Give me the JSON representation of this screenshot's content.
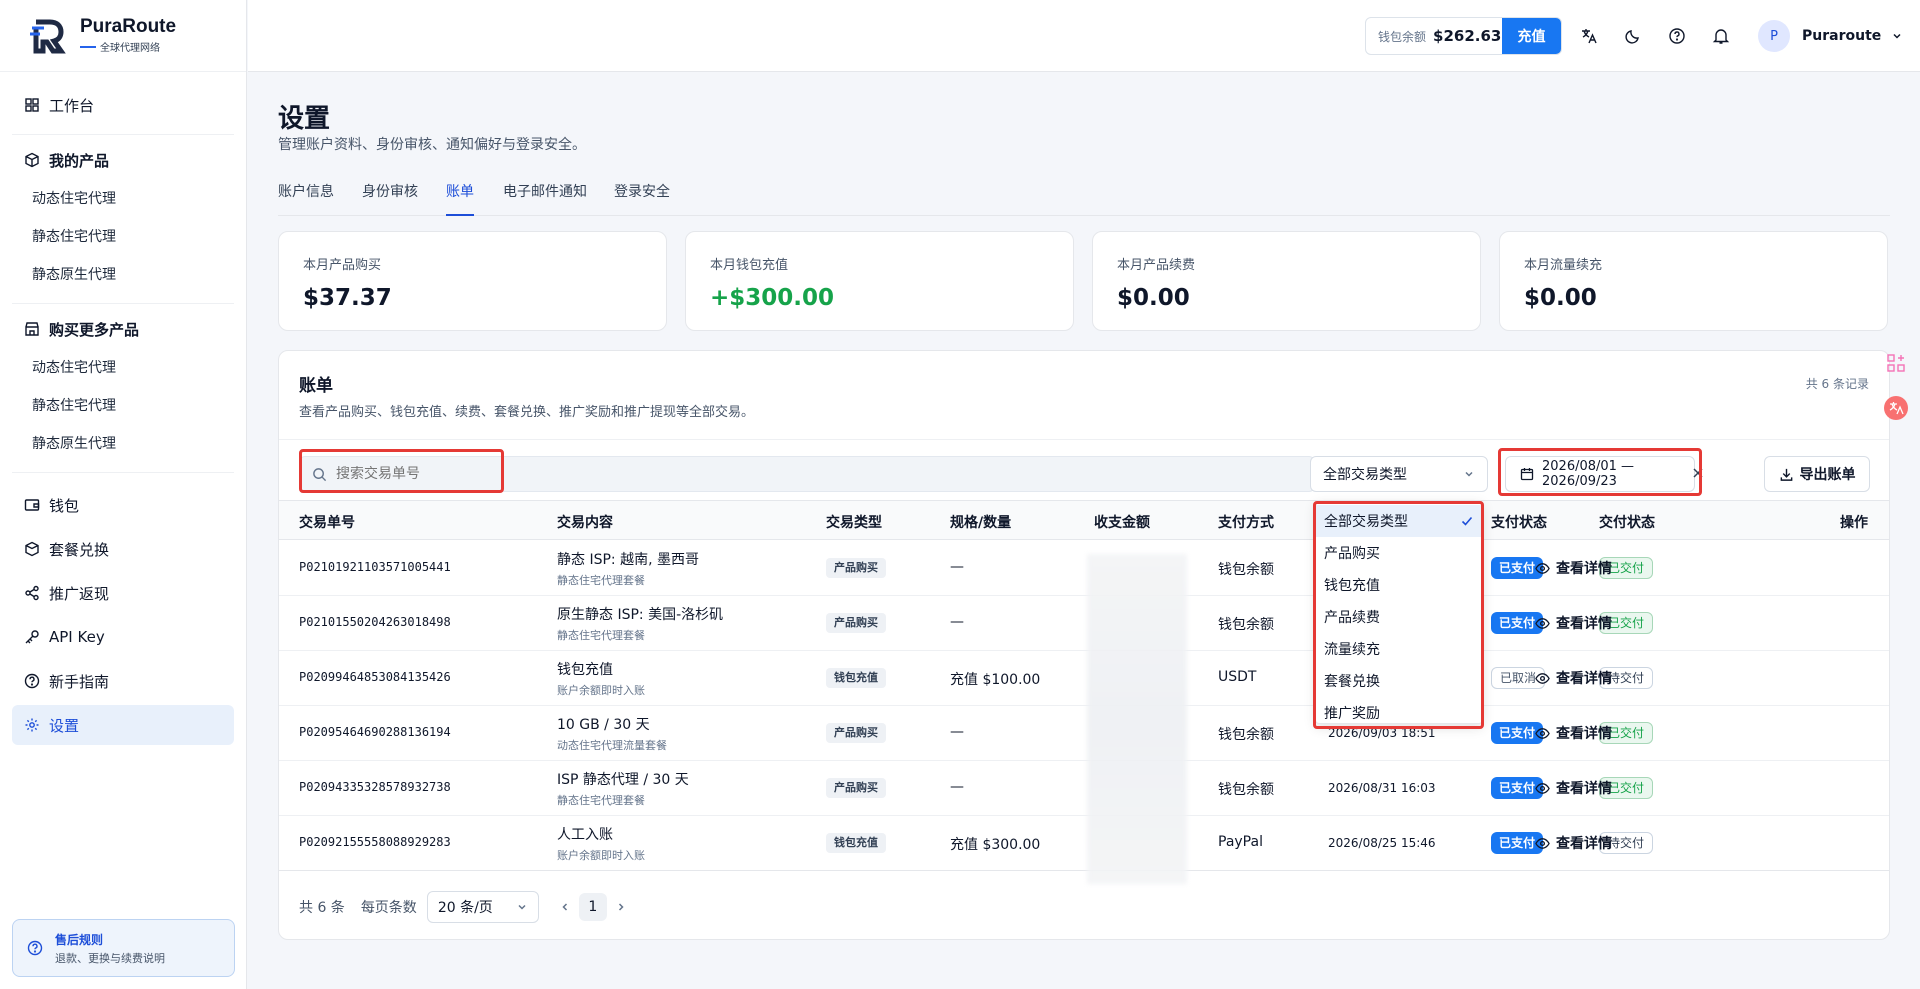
{
  "brand": {
    "name": "PuraRoute",
    "tagline": "全球代理网络"
  },
  "sidebar": {
    "dashboard": "工作台",
    "my_products": {
      "title": "我的产品",
      "items": [
        "动态住宅代理",
        "静态住宅代理",
        "静态原生代理"
      ]
    },
    "buy_more": {
      "title": "购买更多产品",
      "items": [
        "动态住宅代理",
        "静态住宅代理",
        "静态原生代理"
      ]
    },
    "links": [
      "钱包",
      "套餐兑换",
      "推广返现",
      "API Key",
      "新手指南",
      "设置"
    ],
    "after_sale": {
      "title": "售后规则",
      "desc": "退款、更换与续费说明"
    }
  },
  "topbar": {
    "wallet_label": "钱包余额",
    "wallet_amount": "$262.63",
    "recharge": "充值",
    "user_initial": "P",
    "user_name": "Puraroute"
  },
  "page": {
    "title": "设置",
    "subtitle": "管理账户资料、身份审核、通知偏好与登录安全。",
    "tabs": [
      "账户信息",
      "身份审核",
      "账单",
      "电子邮件通知",
      "登录安全"
    ],
    "active_tab": "账单"
  },
  "stats": [
    {
      "label": "本月产品购买",
      "value": "$37.37",
      "color": "#0f172a"
    },
    {
      "label": "本月钱包充值",
      "value": "+$300.00",
      "color": "#16a34a"
    },
    {
      "label": "本月产品续费",
      "value": "$0.00",
      "color": "#0f172a"
    },
    {
      "label": "本月流量续充",
      "value": "$0.00",
      "color": "#0f172a"
    }
  ],
  "billing": {
    "title": "账单",
    "subtitle": "查看产品购买、钱包充值、续费、套餐兑换、推广奖励和推广提现等全部交易。",
    "count": "共 6 条记录",
    "search_placeholder": "搜索交易单号",
    "type_filter": "全部交易类型",
    "date_range": "2026/08/01 — 2026/09/23",
    "export": "导出账单",
    "columns": [
      "交易单号",
      "交易内容",
      "交易类型",
      "规格/数量",
      "收支金额",
      "支付方式",
      "",
      "支付状态",
      "交付状态",
      "操作"
    ],
    "rows": [
      {
        "id": "P02101921103571005441",
        "content": "静态 ISP: 越南, 墨西哥",
        "sub": "静态住宅代理套餐",
        "type": "产品购买",
        "spec": "—",
        "method": "钱包余额",
        "time": "",
        "pay": "已支付",
        "delivery": "已交付",
        "action": "查看详情"
      },
      {
        "id": "P02101550204263018498",
        "content": "原生静态 ISP: 美国-洛杉矶",
        "sub": "静态住宅代理套餐",
        "type": "产品购买",
        "spec": "—",
        "method": "钱包余额",
        "time": "",
        "pay": "已支付",
        "delivery": "已交付",
        "action": "查看详情"
      },
      {
        "id": "P02099464853084135426",
        "content": "钱包充值",
        "sub": "账户余额即时入账",
        "type": "钱包充值",
        "spec": "充值 $100.00",
        "method": "USDT",
        "time": "",
        "pay": "已取消",
        "delivery": "待交付",
        "action": "查看详情"
      },
      {
        "id": "P02095464690288136194",
        "content": "10 GB / 30 天",
        "sub": "动态住宅代理流量套餐",
        "type": "产品购买",
        "spec": "—",
        "method": "钱包余额",
        "time": "2026/09/03 18:51",
        "pay": "已支付",
        "delivery": "已交付",
        "action": "查看详情"
      },
      {
        "id": "P02094335328578932738",
        "content": "ISP 静态代理 / 30 天",
        "sub": "静态住宅代理套餐",
        "type": "产品购买",
        "spec": "—",
        "method": "钱包余额",
        "time": "2026/08/31 16:03",
        "pay": "已支付",
        "delivery": "已交付",
        "action": "查看详情"
      },
      {
        "id": "P02092155558088929283",
        "content": "人工入账",
        "sub": "账户余额即时入账",
        "type": "钱包充值",
        "spec": "充值 $300.00",
        "method": "PayPal",
        "time": "2026/08/25 15:46",
        "pay": "已支付",
        "delivery": "待交付",
        "action": "查看详情"
      }
    ],
    "dropdown": [
      "全部交易类型",
      "产品购买",
      "钱包充值",
      "产品续费",
      "流量续充",
      "套餐兑换",
      "推广奖励"
    ],
    "pager": {
      "total": "共 6 条",
      "per_page_label": "每页条数",
      "per_page": "20 条/页",
      "page": "1"
    }
  }
}
